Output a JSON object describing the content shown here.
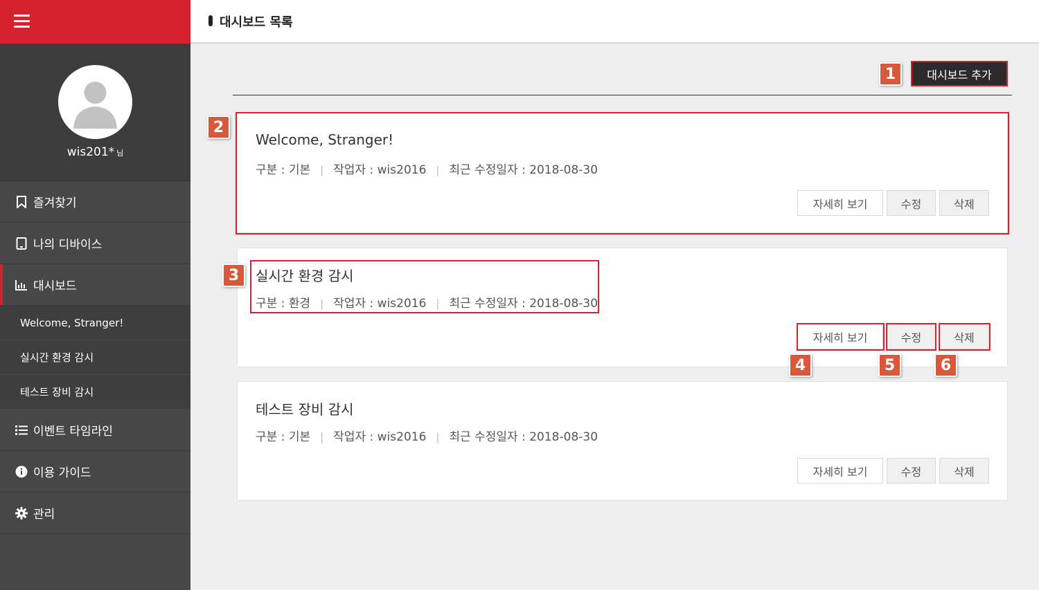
{
  "header": {
    "title": "대시보드 목록"
  },
  "user": {
    "name": "wis201*",
    "suffix": "님"
  },
  "sidebar": {
    "items": [
      {
        "label": "즐겨찾기",
        "icon": "bookmark-icon"
      },
      {
        "label": "나의 디바이스",
        "icon": "tablet-icon"
      },
      {
        "label": "대시보드",
        "icon": "bar-chart-icon",
        "active": true
      },
      {
        "label": "이벤트 타임라인",
        "icon": "list-icon"
      },
      {
        "label": "이용 가이드",
        "icon": "info-icon"
      },
      {
        "label": "관리",
        "icon": "gear-icon"
      }
    ],
    "subitems": [
      "Welcome, Stranger!",
      "실시간 환경 감시",
      "테스트 장비 감시"
    ]
  },
  "toolbar": {
    "add_label": "대시보드 추가"
  },
  "labels": {
    "category_prefix": "구분 : ",
    "author_prefix": "작업자 : ",
    "date_prefix": "최근 수정일자 : "
  },
  "buttons": {
    "detail": "자세히 보기",
    "edit": "수정",
    "delete": "삭제"
  },
  "cards": [
    {
      "title": "Welcome, Stranger!",
      "category": "기본",
      "author": "wis2016",
      "date": "2018-08-30"
    },
    {
      "title": "실시간 환경 감시",
      "category": "환경",
      "author": "wis2016",
      "date": "2018-08-30"
    },
    {
      "title": "테스트 장비 감시",
      "category": "기본",
      "author": "wis2016",
      "date": "2018-08-30"
    }
  ],
  "callouts": [
    "1",
    "2",
    "3",
    "4",
    "5",
    "6"
  ],
  "colors": {
    "brand": "#d6222f",
    "sidebar": "#474747",
    "callout": "#d9573b"
  }
}
